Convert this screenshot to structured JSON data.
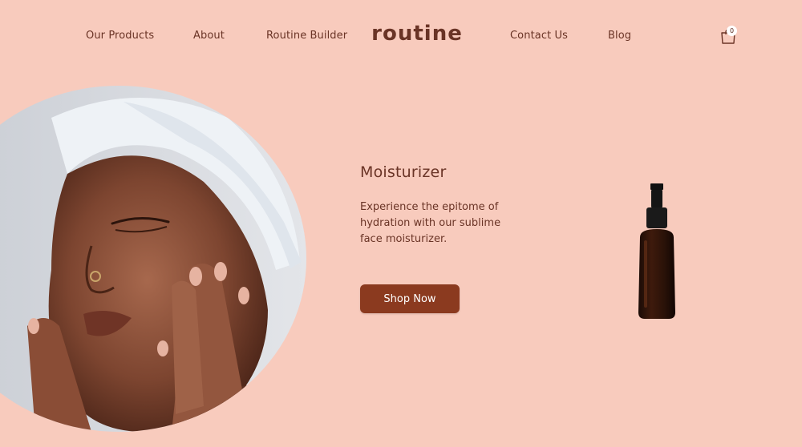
{
  "nav": {
    "items": [
      {
        "label": "Our Products"
      },
      {
        "label": "About"
      },
      {
        "label": "Routine Builder"
      },
      {
        "label": "Contact Us"
      },
      {
        "label": "Blog"
      }
    ],
    "logo_text": "routine",
    "cart_count": "0",
    "cart_icon": "shopping-bag-icon"
  },
  "hero": {
    "title": "Moisturizer",
    "description": "Experience the epitome of hydration with our sublime face moisturizer.",
    "cta_label": "Shop Now"
  },
  "colors": {
    "background": "#f8cbbd",
    "text": "#6a3426",
    "button": "#8b3a1f",
    "button_text": "#ffffff"
  }
}
